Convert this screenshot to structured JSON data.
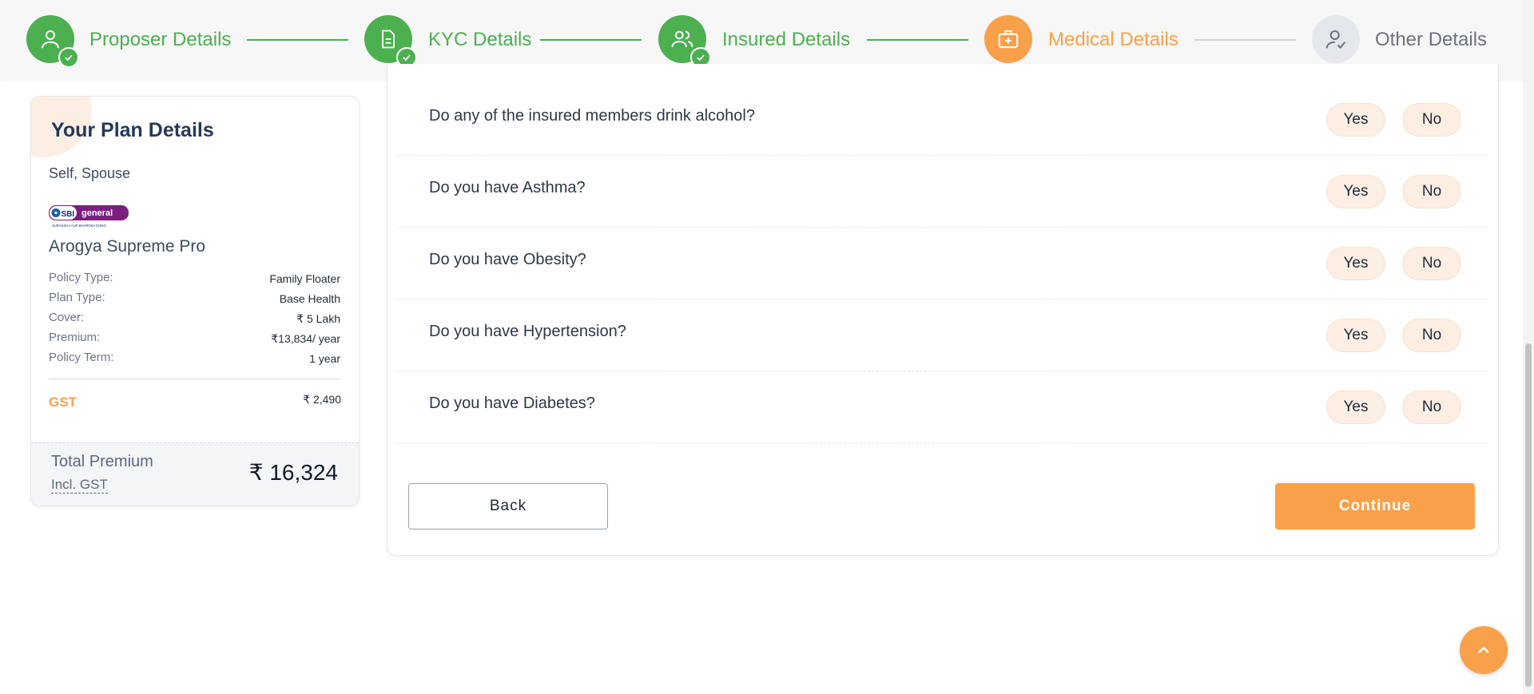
{
  "stepper": {
    "steps": [
      {
        "label": "Proposer Details",
        "icon": "user-icon",
        "status": "done"
      },
      {
        "label": "KYC Details",
        "icon": "document-icon",
        "status": "done"
      },
      {
        "label": "Insured Details",
        "icon": "users-icon",
        "status": "done"
      },
      {
        "label": "Medical Details",
        "icon": "medical-kit-icon",
        "status": "active"
      },
      {
        "label": "Other Details",
        "icon": "user-check-icon",
        "status": "pending"
      }
    ]
  },
  "plan": {
    "title": "Your Plan Details",
    "members": "Self, Spouse",
    "insurer_logo": {
      "brand": "SBI",
      "text": "general",
      "tagline": "SURAKSHA AUR BHAROSA DONO"
    },
    "plan_name": "Arogya Supreme Pro",
    "details": [
      {
        "key": "Policy Type:",
        "value": "Family Floater"
      },
      {
        "key": "Plan Type:",
        "value": "Base Health"
      },
      {
        "key": "Cover:",
        "value": "₹ 5 Lakh"
      },
      {
        "key": "Premium:",
        "value": "₹13,834/ year"
      },
      {
        "key": "Policy Term:",
        "value": "1 year"
      }
    ],
    "gst_label": "GST",
    "gst_value": "₹ 2,490",
    "total_label": "Total Premium",
    "total_sub": "Incl. GST",
    "total_amount": "₹ 16,324"
  },
  "questions": [
    {
      "text": "Do any of the insured members drink alcohol?",
      "yes": "Yes",
      "no": "No"
    },
    {
      "text": "Do you have Asthma?",
      "yes": "Yes",
      "no": "No"
    },
    {
      "text": "Do you have Obesity?",
      "yes": "Yes",
      "no": "No"
    },
    {
      "text": "Do you have Hypertension?",
      "yes": "Yes",
      "no": "No"
    },
    {
      "text": "Do you have Diabetes?",
      "yes": "Yes",
      "no": "No"
    }
  ],
  "actions": {
    "back_label": "Back",
    "continue_label": "Continue"
  },
  "colors": {
    "success": "#4caf50",
    "accent": "#f9a04a",
    "pending": "#e4e7eb",
    "soft": "#fdeee3"
  }
}
